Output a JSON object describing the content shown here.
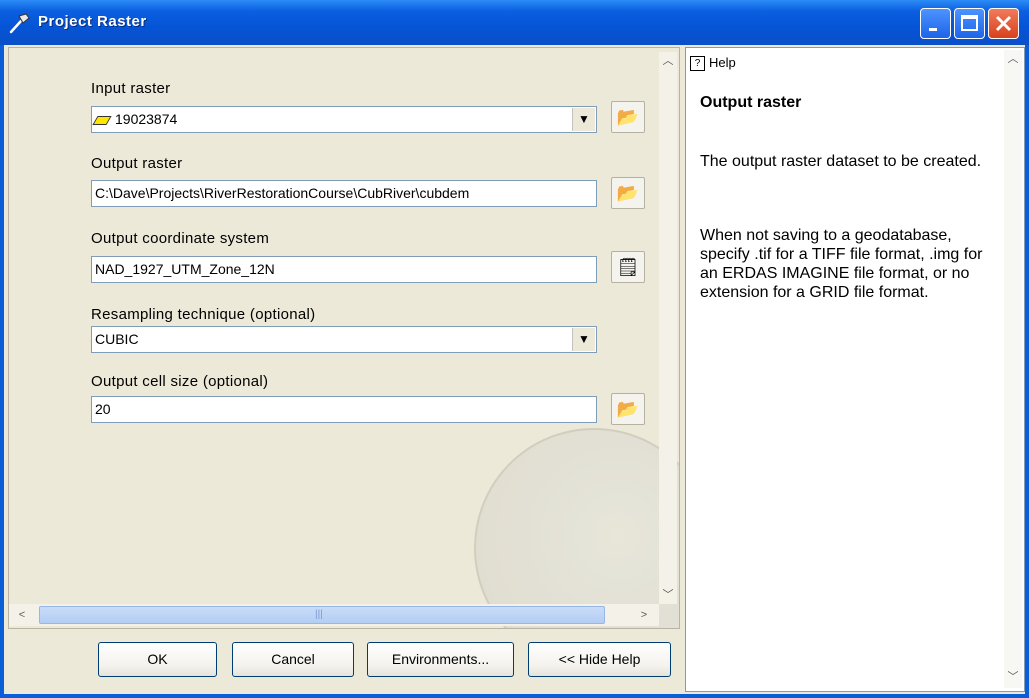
{
  "window": {
    "title": "Project Raster"
  },
  "form": {
    "input_raster": {
      "label": "Input raster",
      "value": "19023874"
    },
    "output_raster": {
      "label": "Output raster",
      "value": "C:\\Dave\\Projects\\RiverRestorationCourse\\CubRiver\\cubdem"
    },
    "coord_system": {
      "label": "Output coordinate system",
      "value": "NAD_1927_UTM_Zone_12N"
    },
    "resampling": {
      "label": "Resampling technique (optional)",
      "value": "CUBIC"
    },
    "cell_size": {
      "label": "Output cell size (optional)",
      "value": "20"
    }
  },
  "buttons": {
    "ok": "OK",
    "cancel": "Cancel",
    "environments": "Environments...",
    "hide_help": "<< Hide Help"
  },
  "help": {
    "tab": "Help",
    "title": "Output raster",
    "para1": "The output raster dataset to be created.",
    "para2": "When not saving to a geodatabase, specify .tif for a TIFF file format, .img for an ERDAS IMAGINE file format, or no extension for a GRID file format."
  }
}
